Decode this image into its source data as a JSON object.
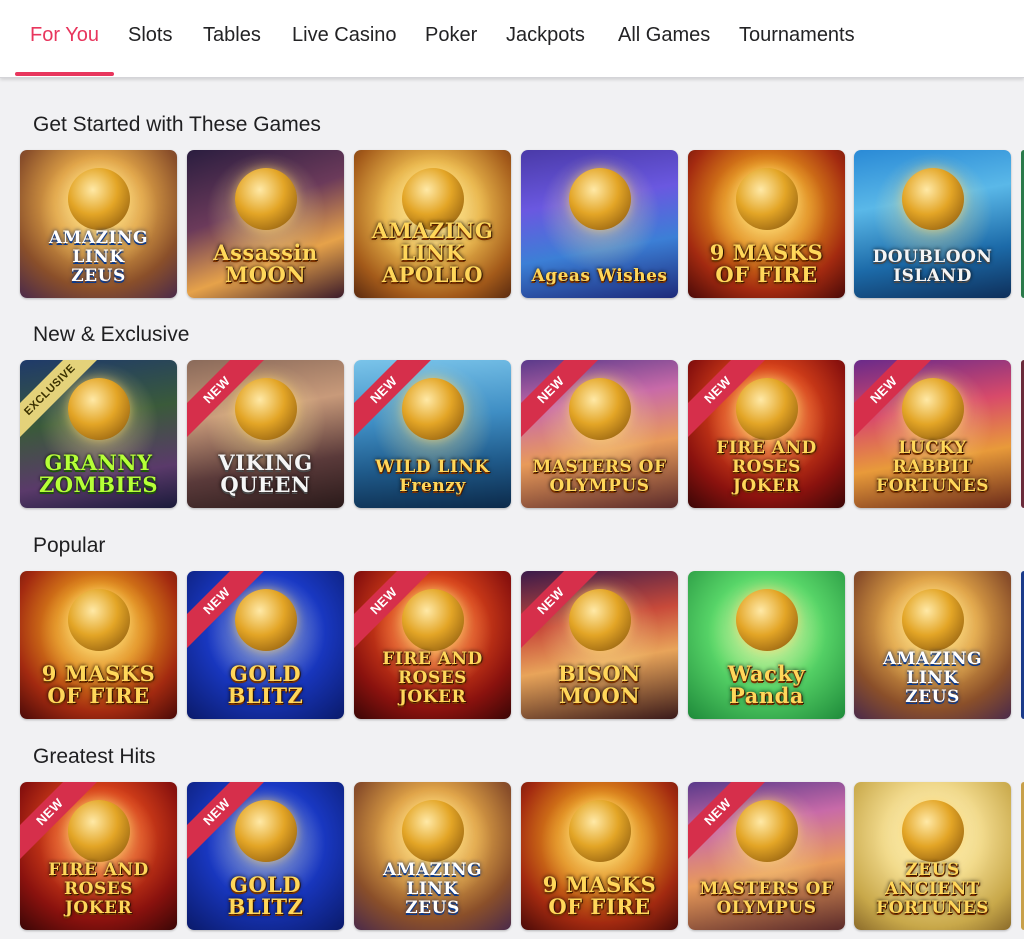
{
  "nav": {
    "tabs": [
      "For You",
      "Slots",
      "Tables",
      "Live Casino",
      "Poker",
      "Jackpots",
      "All Games",
      "Tournaments"
    ],
    "active_index": 0
  },
  "sections": [
    {
      "title": "Get Started with These Games",
      "games": [
        {
          "title": "AMAZING LINK\nZEUS",
          "badge": "",
          "theme": "zeus"
        },
        {
          "title": "Assassin\nMOON",
          "badge": "",
          "theme": "assassin"
        },
        {
          "title": "AMAZING\nLINK\nAPOLLO",
          "badge": "",
          "theme": "apollo"
        },
        {
          "title": "Ageas Wishes",
          "badge": "",
          "theme": "wishes"
        },
        {
          "title": "9 MASKS\nOF FIRE",
          "badge": "",
          "theme": "masks"
        },
        {
          "title": "DOUBLOON\nISLAND",
          "badge": "",
          "theme": "doubloon"
        }
      ]
    },
    {
      "title": "New & Exclusive",
      "games": [
        {
          "title": "GRANNY\nZOMBIES",
          "badge": "EXCLUSIVE",
          "theme": "granny"
        },
        {
          "title": "VIKING\nQUEEN",
          "badge": "NEW",
          "theme": "viking"
        },
        {
          "title": "WILD LINK\nFrenzy",
          "badge": "NEW",
          "theme": "frenzy"
        },
        {
          "title": "MASTERS OF\nOLYMPUS",
          "badge": "NEW",
          "theme": "olympus"
        },
        {
          "title": "FIRE AND ROSES\nJOKER",
          "badge": "NEW",
          "theme": "joker"
        },
        {
          "title": "LUCKY RABBIT\nFORTUNES",
          "badge": "NEW",
          "theme": "rabbit"
        }
      ]
    },
    {
      "title": "Popular",
      "games": [
        {
          "title": "9 MASKS\nOF FIRE",
          "badge": "",
          "theme": "masks"
        },
        {
          "title": "GOLD\nBLITZ",
          "badge": "NEW",
          "theme": "blitz"
        },
        {
          "title": "FIRE AND ROSES\nJOKER",
          "badge": "NEW",
          "theme": "joker"
        },
        {
          "title": "BISON\nMOON",
          "badge": "NEW",
          "theme": "bison"
        },
        {
          "title": "Wacky\nPanda",
          "badge": "",
          "theme": "panda"
        },
        {
          "title": "AMAZING LINK\nZEUS",
          "badge": "",
          "theme": "zeus"
        }
      ]
    },
    {
      "title": "Greatest Hits",
      "games": [
        {
          "title": "FIRE AND ROSES\nJOKER",
          "badge": "NEW",
          "theme": "joker"
        },
        {
          "title": "GOLD\nBLITZ",
          "badge": "NEW",
          "theme": "blitz"
        },
        {
          "title": "AMAZING LINK\nZEUS",
          "badge": "",
          "theme": "zeus"
        },
        {
          "title": "9 MASKS\nOF FIRE",
          "badge": "",
          "theme": "masks"
        },
        {
          "title": "MASTERS OF\nOLYMPUS",
          "badge": "NEW",
          "theme": "olympus"
        },
        {
          "title": "ZEUS\nANCIENT FORTUNES",
          "badge": "",
          "theme": "ancient"
        }
      ]
    }
  ],
  "colors": {
    "accent": "#e8365d",
    "background": "#f1f1f3",
    "ribbon_new": "#d62f4b"
  }
}
